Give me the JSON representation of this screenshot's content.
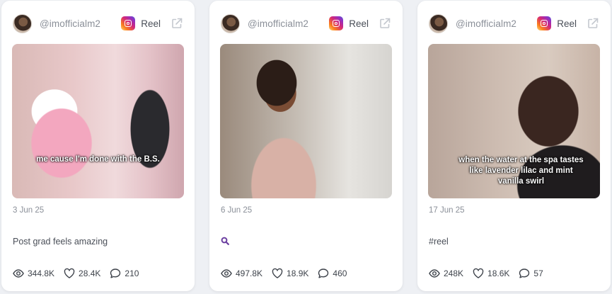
{
  "cards": [
    {
      "username": "@imofficialm2",
      "type_label": "Reel",
      "overlay_text": "me cause I'm done with the B.S.",
      "date": "3 Jun 25",
      "caption": "Post grad feels amazing",
      "views": "344.8K",
      "likes": "28.4K",
      "comments": "210"
    },
    {
      "username": "@imofficialm2",
      "type_label": "Reel",
      "overlay_text": "",
      "date": "6 Jun 25",
      "caption": "",
      "caption_icon": "magnifier-emoji",
      "views": "497.8K",
      "likes": "18.9K",
      "comments": "460"
    },
    {
      "username": "@imofficialm2",
      "type_label": "Reel",
      "overlay_text": "when the water at the spa tastes like lavender lilac and mint vanilla swirl",
      "date": "17 Jun 25",
      "caption": "#reel",
      "views": "248K",
      "likes": "18.6K",
      "comments": "57"
    }
  ],
  "colors": {
    "muted_text": "#8a8f98",
    "body_text": "#4a4f58",
    "card_bg": "#ffffff",
    "page_bg": "#eef0f4",
    "emoji_purple": "#6b3fa0"
  }
}
